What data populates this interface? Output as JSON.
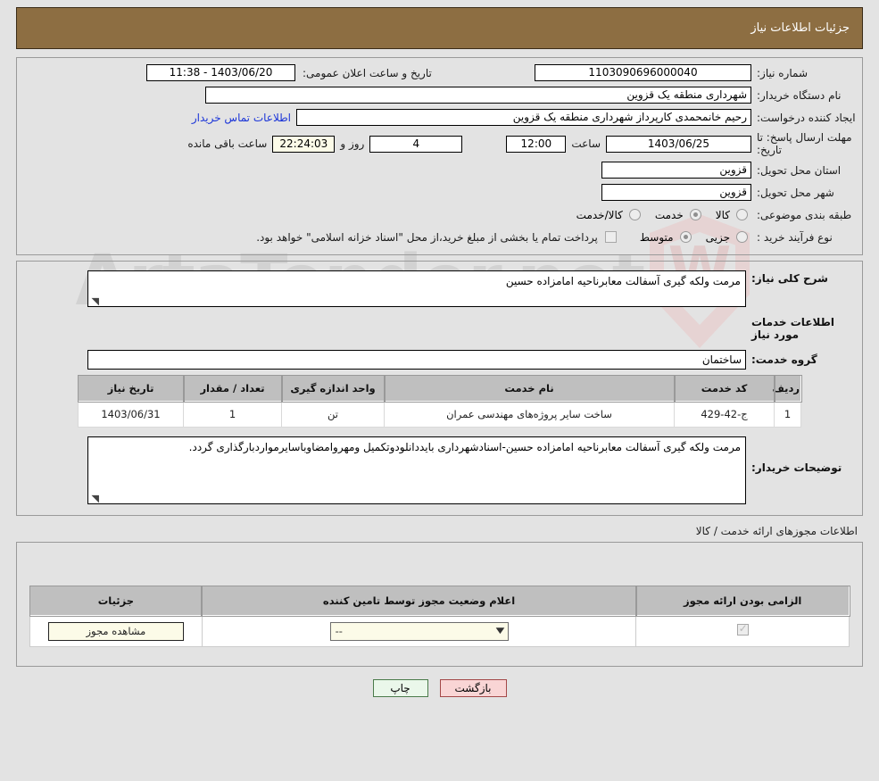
{
  "header": {
    "title": "جزئیات اطلاعات نیاز"
  },
  "top_form": {
    "need_number_label": "شماره نیاز:",
    "need_number_value": "1103090696000040",
    "announce_label": "تاریخ و ساعت اعلان عمومی:",
    "announce_value": "1403/06/20 - 11:38",
    "buyer_org_label": "نام دستگاه خریدار:",
    "buyer_org_value": "شهرداری منطقه یک قزوین",
    "creator_label": "ایجاد کننده درخواست:",
    "creator_value": "رحیم خانمحمدی کارپرداز شهرداری منطقه یک قزوین",
    "contact_link": "اطلاعات تماس خریدار",
    "deadline_label": "مهلت ارسال پاسخ: تا تاریخ:",
    "deadline_date": "1403/06/25",
    "hour_label": "ساعت",
    "deadline_hour": "12:00",
    "remaining_days": "4",
    "days_and_label": "روز و",
    "remaining_time": "22:24:03",
    "remaining_suffix": "ساعت باقی مانده",
    "province_label": "استان محل تحویل:",
    "province_value": "قزوین",
    "city_label": "شهر محل تحویل:",
    "city_value": "قزوین",
    "category_label": "طبقه بندی موضوعی:",
    "category_options": [
      {
        "label": "کالا",
        "selected": false
      },
      {
        "label": "خدمت",
        "selected": true
      },
      {
        "label": "کالا/خدمت",
        "selected": false
      }
    ],
    "process_label": "نوع فرآیند خرید :",
    "process_options": [
      {
        "label": "جزیی",
        "selected": false
      },
      {
        "label": "متوسط",
        "selected": true
      }
    ],
    "treasury_checked": false,
    "treasury_note": "پرداخت تمام یا بخشی از مبلغ خرید،از محل \"اسناد خزانه اسلامی\" خواهد بود."
  },
  "mid": {
    "summary_label": "شرح کلی نیاز:",
    "summary_value": "مرمت ولکه گیری آسفالت معابرناحیه امامزاده حسین",
    "services_section_title": "اطلاعات خدمات مورد نیاز",
    "service_group_label": "گروه خدمت:",
    "service_group_value": "ساختمان",
    "table": {
      "columns": [
        "ردیف",
        "کد خدمت",
        "نام خدمت",
        "واحد اندازه گیری",
        "تعداد / مقدار",
        "تاریخ نیاز"
      ],
      "rows": [
        [
          "1",
          "ج-42-429",
          "ساخت سایر پروژه‌های مهندسی عمران",
          "تن",
          "1",
          "1403/06/31"
        ]
      ]
    },
    "notes_label": "توضیحات خریدار:",
    "notes_value": "مرمت ولکه گیری آسفالت معابرناحیه امامزاده حسین-اسنادشهرداری بایددانلودوتکمیل ومهروامضاوباسایرمواردبارگذاری گردد."
  },
  "licenses": {
    "caption": "اطلاعات مجوزهای ارائه خدمت / کالا",
    "columns": [
      "الزامی بودن ارائه مجوز",
      "اعلام وضعیت مجوز توسط تامین کننده",
      "جزئیات"
    ],
    "rows": [
      {
        "required": true,
        "status_value": "--",
        "details_button": "مشاهده مجوز"
      }
    ]
  },
  "footer": {
    "print_label": "چاپ",
    "back_label": "بازگشت"
  },
  "watermark": {
    "text": "ArtaTender.net"
  },
  "colors": {
    "header_bg": "#8d6e42",
    "link": "#1a34d8",
    "table_header": "#bfbfbf",
    "highlight_field": "#fcfbe8",
    "print_btn": "#eaf7ea",
    "back_btn": "#f9d5d5"
  }
}
